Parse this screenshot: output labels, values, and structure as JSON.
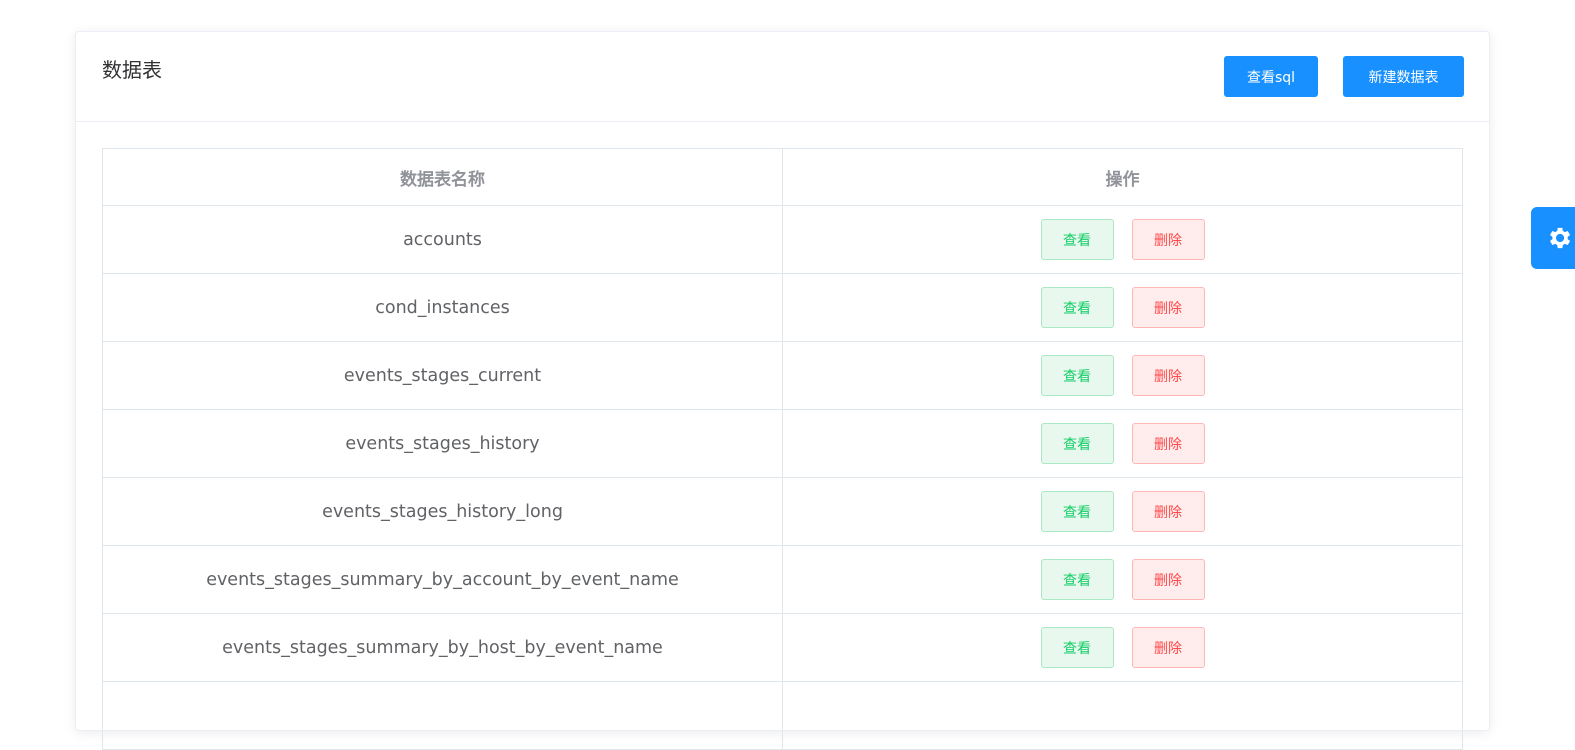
{
  "header": {
    "title": "数据表",
    "view_sql_label": "查看sql",
    "new_table_label": "新建数据表"
  },
  "table": {
    "columns": [
      "数据表名称",
      "操作"
    ],
    "view_label": "查看",
    "delete_label": "删除",
    "rows": [
      "accounts",
      "cond_instances",
      "events_stages_current",
      "events_stages_history",
      "events_stages_history_long",
      "events_stages_summary_by_account_by_event_name",
      "events_stages_summary_by_host_by_event_name",
      ""
    ]
  },
  "side_tab": {
    "icon": "gear-icon"
  },
  "colors": {
    "primary": "#1890ff",
    "success": "#13ce66",
    "danger": "#ff4949"
  }
}
